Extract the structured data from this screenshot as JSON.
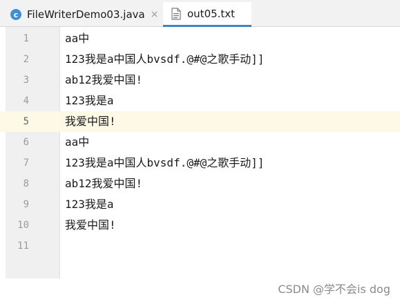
{
  "tabs": [
    {
      "label": "FileWriterDemo03.java",
      "icon": "java-class-icon",
      "active": false,
      "close": "×"
    },
    {
      "label": "out05.txt",
      "icon": "text-file-icon",
      "active": true
    }
  ],
  "editor": {
    "current_line": 5,
    "lines": [
      {
        "num": "1",
        "text": "aa中"
      },
      {
        "num": "2",
        "text": "123我是a中国人bvsdf.@#@之歌手动]]"
      },
      {
        "num": "3",
        "text": "ab12我爱中国!"
      },
      {
        "num": "4",
        "text": "123我是a"
      },
      {
        "num": "5",
        "text": "我爱中国!"
      },
      {
        "num": "6",
        "text": "aa中"
      },
      {
        "num": "7",
        "text": "123我是a中国人bvsdf.@#@之歌手动]]"
      },
      {
        "num": "8",
        "text": "ab12我爱中国!"
      },
      {
        "num": "9",
        "text": "123我是a"
      },
      {
        "num": "10",
        "text": "我爱中国!"
      },
      {
        "num": "11",
        "text": ""
      }
    ]
  },
  "watermark": "CSDN @学不会is dog",
  "colors": {
    "active_tab_underline": "#4083c9",
    "current_line_bg": "#fcfae6",
    "gutter_bg": "#f0f0f0"
  }
}
